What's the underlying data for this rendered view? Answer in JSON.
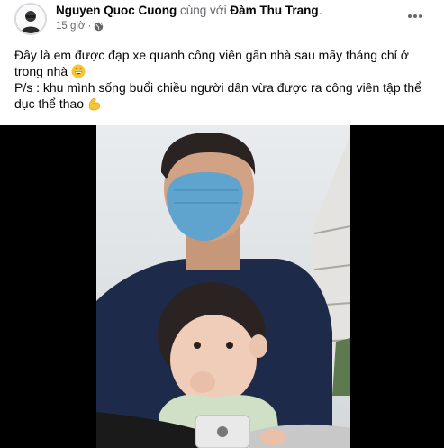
{
  "post": {
    "author": "Nguyen Quoc Cuong",
    "with_text": "cùng với",
    "tagged": "Đàm Thu Trang",
    "period": ".",
    "time": "15 giờ",
    "separator": "·",
    "privacy_icon": "globe-icon",
    "more_icon": "more-horizontal-icon",
    "text_line1": "Đây là em được đạp xe quanh công viên gần nhà sau mấy tháng chỉ ở trong nhà",
    "text_line1_emoji": "grinning-face-emoji",
    "text_line2": "P/s : khu mình sống buổi chiều người dân vừa được ra công viên tập thể dục thể thao",
    "text_line2_emoji": "flexed-biceps-emoji"
  },
  "colors": {
    "secondary_text": "#65676b",
    "video_background": "#000000",
    "emoji_yellow": "#f7c531"
  }
}
